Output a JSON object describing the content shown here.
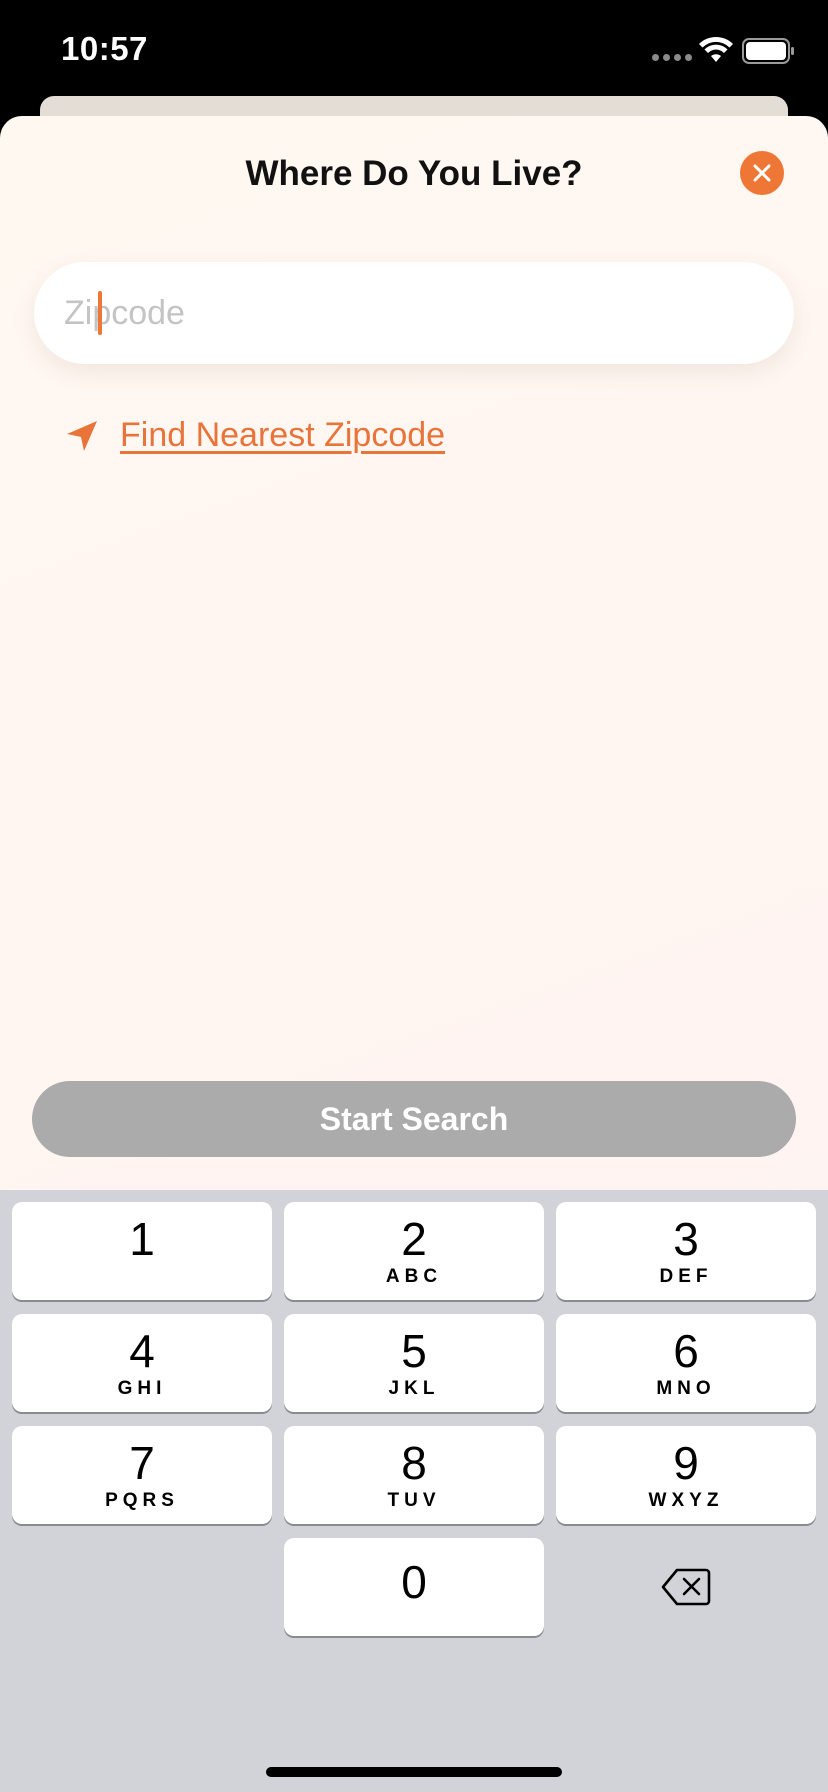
{
  "status_bar": {
    "time": "10:57"
  },
  "sheet": {
    "title": "Where Do You Live?",
    "zip_input": {
      "value": "",
      "placeholder": "Zipcode"
    },
    "find_nearest_label": "Find Nearest Zipcode",
    "start_search_label": "Start Search"
  },
  "colors": {
    "accent": "#ef7735",
    "disabled_button": "#ababab",
    "keyboard_bg": "#d1d3d9"
  },
  "keyboard": {
    "keys": [
      {
        "num": "1",
        "letters": ""
      },
      {
        "num": "2",
        "letters": "ABC"
      },
      {
        "num": "3",
        "letters": "DEF"
      },
      {
        "num": "4",
        "letters": "GHI"
      },
      {
        "num": "5",
        "letters": "JKL"
      },
      {
        "num": "6",
        "letters": "MNO"
      },
      {
        "num": "7",
        "letters": "PQRS"
      },
      {
        "num": "8",
        "letters": "TUV"
      },
      {
        "num": "9",
        "letters": "WXYZ"
      },
      {
        "num": "0",
        "letters": ""
      }
    ],
    "delete_icon": "delete-backward-icon"
  }
}
